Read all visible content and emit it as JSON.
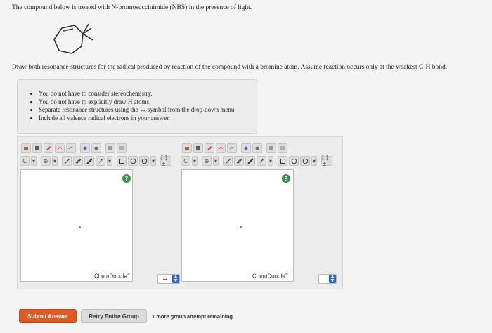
{
  "question": {
    "intro": "The compound below is treated with N-bromosuccinimide (NBS) in the presence of light.",
    "instruction": "Draw both resonance structures for the radical produced by reaction of the compound with a bromine atom. Assume reaction occurs only at the weakest C-H bond."
  },
  "hints": [
    "You do not have to consider stereochemistry.",
    "You do not have to explicitly draw H atoms.",
    "Separate resonance structures using the ↔ symbol from the drop-down menu.",
    "Include all valence radical electrons in your answer."
  ],
  "editors": [
    {
      "name": "left",
      "element_label": "C",
      "charge_label": "⊕",
      "help_label": "?",
      "brand": "ChemDoodle",
      "brand_mark": "®",
      "bracket_label": "[ ]±"
    },
    {
      "name": "right",
      "element_label": "C",
      "charge_label": "⊕",
      "help_label": "?",
      "brand": "ChemDoodle",
      "brand_mark": "®",
      "bracket_label": "[ ]±"
    }
  ],
  "separator": {
    "left_value": "↔",
    "right_value": ""
  },
  "buttons": {
    "submit": "Submit Answer",
    "retry": "Retry Entire Group"
  },
  "attempts_text": "1 more group attempt remaining",
  "colors": {
    "submit_bg": "#e05a24",
    "help_icon": "#3f8f4c",
    "spinner": "#2a68c8"
  }
}
